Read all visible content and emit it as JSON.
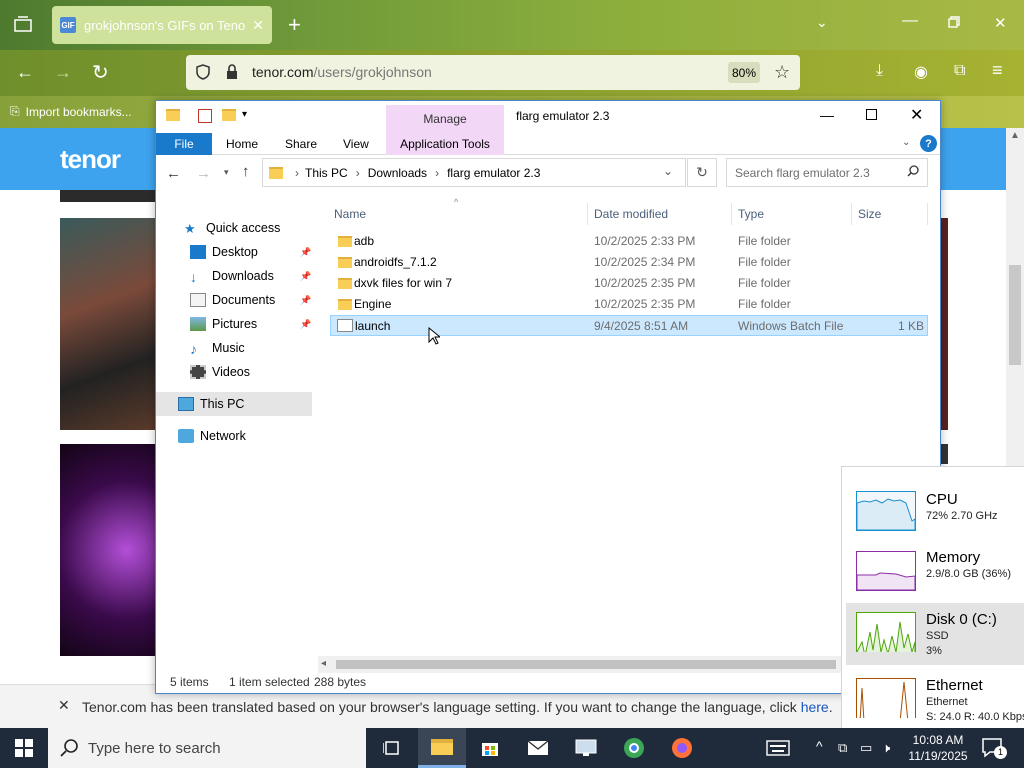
{
  "browser": {
    "tab_title": "grokjohnson's GIFs on Tenor",
    "url_domain": "tenor.com",
    "url_path": "/users/grokjohnson",
    "zoom": "80%",
    "bookmark": "Import bookmarks..."
  },
  "tenor": {
    "logo": "tenor",
    "notice_text": "Tenor.com has been translated based on your browser's language setting. If you want to change the language, click",
    "notice_link": "here",
    "notice_end": "."
  },
  "explorer": {
    "manage": "Manage",
    "title": "flarg emulator 2.3",
    "ribbon_tabs": [
      "File",
      "Home",
      "Share",
      "View",
      "Application Tools"
    ],
    "breadcrumb": [
      "This PC",
      "Downloads",
      "flarg emulator 2.3"
    ],
    "search_placeholder": "Search flarg emulator 2.3",
    "nav": [
      {
        "label": "Quick access",
        "icon": "star-icon"
      },
      {
        "label": "Desktop",
        "icon": "desktop-icon",
        "pinned": true
      },
      {
        "label": "Downloads",
        "icon": "download-icon",
        "pinned": true
      },
      {
        "label": "Documents",
        "icon": "documents-icon",
        "pinned": true
      },
      {
        "label": "Pictures",
        "icon": "pictures-icon",
        "pinned": true
      },
      {
        "label": "Music",
        "icon": "music-icon"
      },
      {
        "label": "Videos",
        "icon": "videos-icon"
      },
      {
        "label": "This PC",
        "icon": "computer-icon",
        "selected": true
      },
      {
        "label": "Network",
        "icon": "network-icon"
      }
    ],
    "columns": [
      "Name",
      "Date modified",
      "Type",
      "Size"
    ],
    "files": [
      {
        "name": "adb",
        "date": "10/2/2025 2:33 PM",
        "type": "File folder",
        "size": "",
        "kind": "folder"
      },
      {
        "name": "androidfs_7.1.2",
        "date": "10/2/2025 2:34 PM",
        "type": "File folder",
        "size": "",
        "kind": "folder"
      },
      {
        "name": "dxvk files for win 7",
        "date": "10/2/2025 2:35 PM",
        "type": "File folder",
        "size": "",
        "kind": "folder"
      },
      {
        "name": "Engine",
        "date": "10/2/2025 2:35 PM",
        "type": "File folder",
        "size": "",
        "kind": "folder"
      },
      {
        "name": "launch",
        "date": "9/4/2025 8:51 AM",
        "type": "Windows Batch File",
        "size": "1 KB",
        "kind": "bat",
        "selected": true
      }
    ],
    "status_items": "5 items",
    "status_selected": "1 item selected",
    "status_bytes": "288 bytes"
  },
  "taskmanager": {
    "items": [
      {
        "name": "CPU",
        "sub": "72%  2.70 GHz",
        "color": "#1a8fd1"
      },
      {
        "name": "Memory",
        "sub": "2.9/8.0 GB (36%)",
        "color": "#8b2fa6"
      },
      {
        "name": "Disk 0 (C:)",
        "sub": "SSD",
        "sub2": "3%",
        "color": "#4da60c",
        "selected": true
      },
      {
        "name": "Ethernet",
        "sub": "Ethernet",
        "sub2": "S: 24.0  R: 40.0 Kbps",
        "color": "#a74f01"
      }
    ]
  },
  "taskbar": {
    "search_placeholder": "Type here to search",
    "time": "10:08 AM",
    "date": "11/19/2025",
    "notification_count": "1"
  }
}
